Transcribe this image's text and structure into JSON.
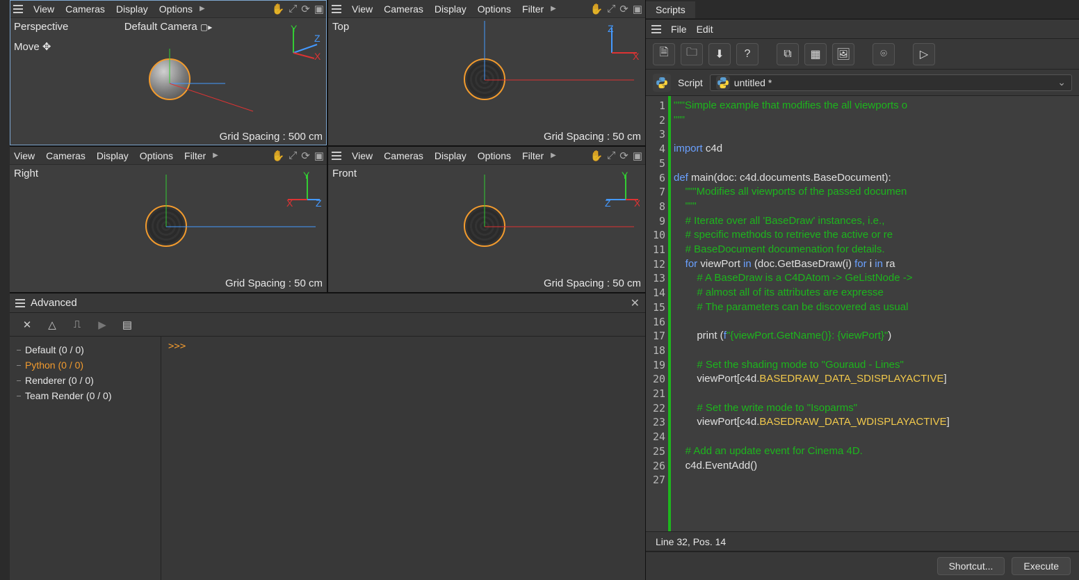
{
  "viewports": {
    "menus_full": [
      "View",
      "Cameras",
      "Display",
      "Options"
    ],
    "menus_with_filter": [
      "View",
      "Cameras",
      "Display",
      "Options",
      "Filter"
    ],
    "perspective": {
      "label": "Perspective",
      "camera": "Default Camera",
      "tool": "Move",
      "grid": "Grid Spacing : 500 cm"
    },
    "top": {
      "label": "Top",
      "grid": "Grid Spacing : 50 cm"
    },
    "right": {
      "label": "Right",
      "grid": "Grid Spacing : 50 cm"
    },
    "front": {
      "label": "Front",
      "grid": "Grid Spacing : 50 cm"
    }
  },
  "console": {
    "title": "Advanced",
    "prompt": ">>>",
    "tree": [
      {
        "label": "Default (0 / 0)",
        "active": false
      },
      {
        "label": "Python (0 / 0)",
        "active": true
      },
      {
        "label": "Renderer (0 / 0)",
        "active": false
      },
      {
        "label": "Team Render  (0 / 0)",
        "active": false
      }
    ]
  },
  "scripts": {
    "tab": "Scripts",
    "menus": [
      "File",
      "Edit"
    ],
    "script_label": "Script",
    "script_name": "untitled *",
    "status": "Line 32, Pos. 14",
    "buttons": {
      "shortcut": "Shortcut...",
      "execute": "Execute"
    },
    "code_lines": [
      {
        "n": "1",
        "frags": [
          {
            "c": "cs",
            "t": "\"\"\"Simple example that modifies the all viewports o"
          }
        ]
      },
      {
        "n": "2",
        "frags": [
          {
            "c": "cs",
            "t": "\"\"\""
          }
        ]
      },
      {
        "n": "3",
        "frags": []
      },
      {
        "n": "4",
        "frags": [
          {
            "c": "ck",
            "t": "import"
          },
          {
            "c": "cn",
            "t": " c4d"
          }
        ]
      },
      {
        "n": "5",
        "frags": []
      },
      {
        "n": "6",
        "frags": [
          {
            "c": "ck",
            "t": "def"
          },
          {
            "c": "cn",
            "t": " main(doc: c4d.documents.BaseDocument):"
          }
        ]
      },
      {
        "n": "7",
        "frags": [
          {
            "c": "cn",
            "t": "    "
          },
          {
            "c": "cs",
            "t": "\"\"\"Modifies all viewports of the passed documen"
          }
        ]
      },
      {
        "n": "8",
        "frags": [
          {
            "c": "cn",
            "t": "    "
          },
          {
            "c": "cs",
            "t": "\"\"\""
          }
        ]
      },
      {
        "n": "9",
        "frags": [
          {
            "c": "cn",
            "t": "    "
          },
          {
            "c": "cs",
            "t": "# Iterate over all 'BaseDraw' instances, i.e.,"
          }
        ]
      },
      {
        "n": "10",
        "frags": [
          {
            "c": "cn",
            "t": "    "
          },
          {
            "c": "cs",
            "t": "# specific methods to retrieve the active or re"
          }
        ]
      },
      {
        "n": "11",
        "frags": [
          {
            "c": "cn",
            "t": "    "
          },
          {
            "c": "cs",
            "t": "# BaseDocument documenation for details."
          }
        ]
      },
      {
        "n": "12",
        "frags": [
          {
            "c": "cn",
            "t": "    "
          },
          {
            "c": "ck",
            "t": "for"
          },
          {
            "c": "cn",
            "t": " viewPort "
          },
          {
            "c": "ck",
            "t": "in"
          },
          {
            "c": "cn",
            "t": " (doc.GetBaseDraw(i) "
          },
          {
            "c": "ck",
            "t": "for"
          },
          {
            "c": "cn",
            "t": " i "
          },
          {
            "c": "ck",
            "t": "in"
          },
          {
            "c": "cn",
            "t": " ra"
          }
        ]
      },
      {
        "n": "13",
        "frags": [
          {
            "c": "cn",
            "t": "        "
          },
          {
            "c": "cs",
            "t": "# A BaseDraw is a C4DAtom -> GeListNode ->"
          }
        ]
      },
      {
        "n": "14",
        "frags": [
          {
            "c": "cn",
            "t": "        "
          },
          {
            "c": "cs",
            "t": "# almost all of its attributes are expresse"
          }
        ]
      },
      {
        "n": "15",
        "frags": [
          {
            "c": "cn",
            "t": "        "
          },
          {
            "c": "cs",
            "t": "# The parameters can be discovered as usual"
          }
        ]
      },
      {
        "n": "16",
        "frags": []
      },
      {
        "n": "17",
        "frags": [
          {
            "c": "cn",
            "t": "        print ("
          },
          {
            "c": "ck",
            "t": "f"
          },
          {
            "c": "cs",
            "t": "\"{viewPort.GetName()}: {viewPort}\""
          },
          {
            "c": "cn",
            "t": ")"
          }
        ]
      },
      {
        "n": "18",
        "frags": []
      },
      {
        "n": "19",
        "frags": [
          {
            "c": "cn",
            "t": "        "
          },
          {
            "c": "cs",
            "t": "# Set the shading mode to \"Gouraud - Lines\""
          }
        ]
      },
      {
        "n": "20",
        "frags": [
          {
            "c": "cn",
            "t": "        viewPort[c4d."
          },
          {
            "c": "cy",
            "t": "BASEDRAW_DATA_SDISPLAYACTIVE"
          },
          {
            "c": "cn",
            "t": "]"
          }
        ]
      },
      {
        "n": "21",
        "frags": []
      },
      {
        "n": "22",
        "frags": [
          {
            "c": "cn",
            "t": "        "
          },
          {
            "c": "cs",
            "t": "# Set the write mode to \"Isoparms\""
          }
        ]
      },
      {
        "n": "23",
        "frags": [
          {
            "c": "cn",
            "t": "        viewPort[c4d."
          },
          {
            "c": "cy",
            "t": "BASEDRAW_DATA_WDISPLAYACTIVE"
          },
          {
            "c": "cn",
            "t": "]"
          }
        ]
      },
      {
        "n": "24",
        "frags": []
      },
      {
        "n": "25",
        "frags": [
          {
            "c": "cn",
            "t": "    "
          },
          {
            "c": "cs",
            "t": "# Add an update event for Cinema 4D."
          }
        ]
      },
      {
        "n": "26",
        "frags": [
          {
            "c": "cn",
            "t": "    c4d.EventAdd()"
          }
        ]
      },
      {
        "n": "27",
        "frags": []
      }
    ]
  }
}
